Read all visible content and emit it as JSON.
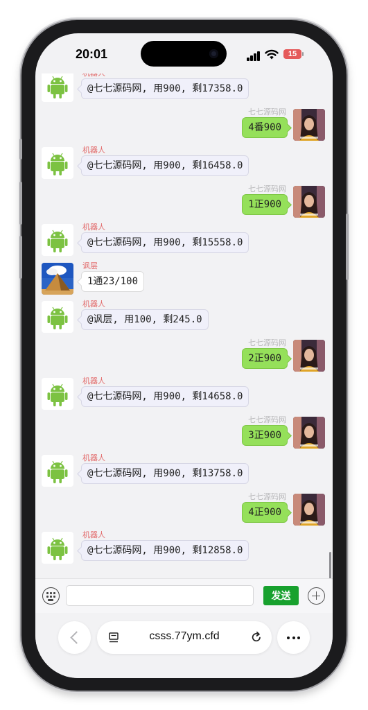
{
  "status_bar": {
    "time": "20:01",
    "battery": "15"
  },
  "bot_name": "机器人",
  "user_name": "七七源码网",
  "messages": [
    {
      "side": "left",
      "sender": "机器人",
      "text": "@七七源码网, 用900, 剩17358.0",
      "avatar": "android-icon"
    },
    {
      "side": "right",
      "sender": "七七源码网",
      "text": "4番900",
      "avatar": "user-avatar"
    },
    {
      "side": "left",
      "sender": "机器人",
      "text": "@七七源码网, 用900, 剩16458.0",
      "avatar": "android-icon"
    },
    {
      "side": "right",
      "sender": "七七源码网",
      "text": "1正900",
      "avatar": "user-avatar"
    },
    {
      "side": "left",
      "sender": "机器人",
      "text": "@七七源码网, 用900, 剩15558.0",
      "avatar": "android-icon"
    },
    {
      "side": "left",
      "sender": "讽层",
      "text": "1通23/100",
      "avatar": "pyramid-avatar"
    },
    {
      "side": "left",
      "sender": "机器人",
      "text": "@讽层, 用100, 剩245.0",
      "avatar": "android-icon"
    },
    {
      "side": "right",
      "sender": "七七源码网",
      "text": "2正900",
      "avatar": "user-avatar"
    },
    {
      "side": "left",
      "sender": "机器人",
      "text": "@七七源码网, 用900, 剩14658.0",
      "avatar": "android-icon"
    },
    {
      "side": "right",
      "sender": "七七源码网",
      "text": "3正900",
      "avatar": "user-avatar"
    },
    {
      "side": "left",
      "sender": "机器人",
      "text": "@七七源码网, 用900, 剩13758.0",
      "avatar": "android-icon"
    },
    {
      "side": "right",
      "sender": "七七源码网",
      "text": "4正900",
      "avatar": "user-avatar"
    },
    {
      "side": "left",
      "sender": "机器人",
      "text": "@七七源码网, 用900, 剩12858.0",
      "avatar": "android-icon"
    }
  ],
  "input": {
    "value": "",
    "placeholder": "",
    "send_label": "发送"
  },
  "browser": {
    "url": "csss.77ym.cfd"
  },
  "colors": {
    "send_button": "#18a12e",
    "user_bubble": "#95e05a",
    "bot_bubble": "#f0f0fa",
    "sender_name": "#e26b6b"
  }
}
